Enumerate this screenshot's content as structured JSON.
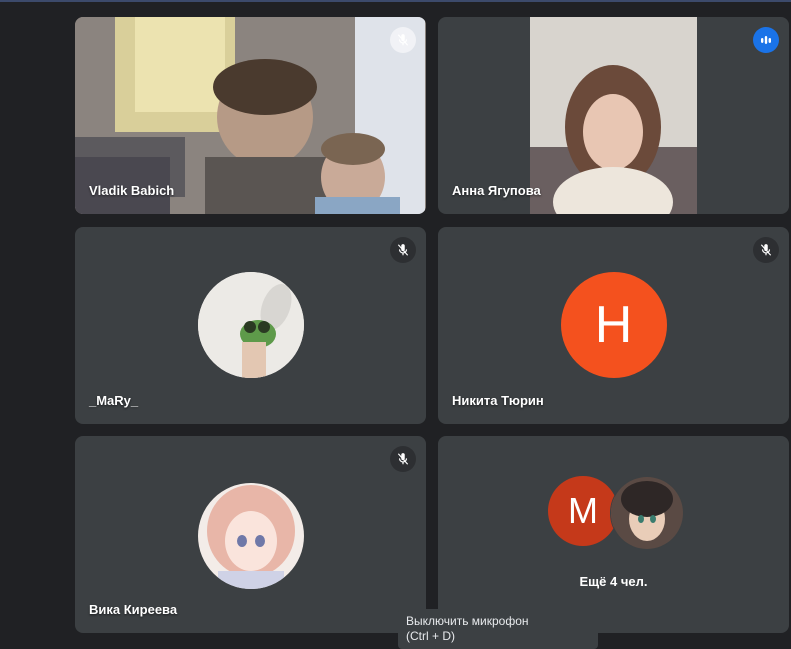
{
  "participants": [
    {
      "name": "Vladik Babich",
      "muted": true
    },
    {
      "name": "Анна Ягупова",
      "speaking": true
    },
    {
      "name": "_MaRy_",
      "muted": true
    },
    {
      "name": "Никита Тюрин",
      "muted": true,
      "avatar_letter": "H",
      "avatar_color": "#f4511e"
    },
    {
      "name": "Вика Киреева",
      "muted": true
    }
  ],
  "overflow": {
    "avatar_letter": "M",
    "avatar_color": "#c5391a",
    "label": "Ещё 4 чел."
  },
  "tooltip": {
    "line1": "Выключить микрофон",
    "line2": "(Ctrl + D)"
  },
  "icons": {
    "muted": "mic-off-icon",
    "speaking": "audio-level-icon"
  }
}
